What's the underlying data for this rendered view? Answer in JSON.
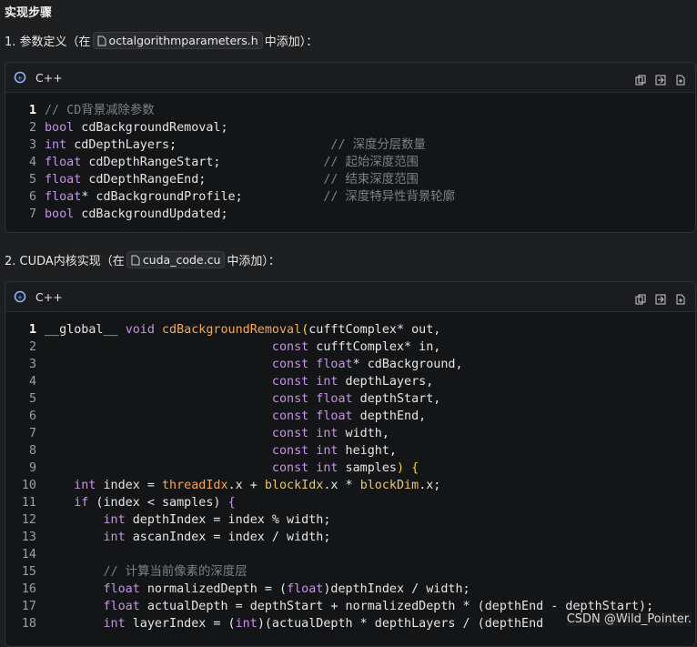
{
  "heading": "实现步骤",
  "step1": {
    "prefix": "1. 参数定义（在",
    "file": "octalgorithmparameters.h",
    "suffix": "中添加）："
  },
  "step2": {
    "prefix": "2. CUDA内核实现（在",
    "file": "cuda_code.cu",
    "suffix": "中添加）："
  },
  "card1": {
    "lang": "C++",
    "lines": [
      {
        "n": "1",
        "t": [
          [
            "cm",
            "// CD背景减除参数"
          ]
        ]
      },
      {
        "n": "2",
        "t": [
          [
            "kw",
            "bool"
          ],
          [
            "txt",
            " cdBackgroundRemoval;"
          ]
        ]
      },
      {
        "n": "3",
        "t": [
          [
            "kw",
            "int"
          ],
          [
            "txt",
            " cdDepthLayers;                     "
          ],
          [
            "cm",
            "// 深度分层数量"
          ]
        ]
      },
      {
        "n": "4",
        "t": [
          [
            "kw",
            "float"
          ],
          [
            "txt",
            " cdDepthRangeStart;              "
          ],
          [
            "cm",
            "// 起始深度范围"
          ]
        ]
      },
      {
        "n": "5",
        "t": [
          [
            "kw",
            "float"
          ],
          [
            "txt",
            " cdDepthRangeEnd;                "
          ],
          [
            "cm",
            "// 结束深度范围"
          ]
        ]
      },
      {
        "n": "6",
        "t": [
          [
            "kw",
            "float"
          ],
          [
            "txt",
            "* cdBackgroundProfile;           "
          ],
          [
            "cm",
            "// 深度特异性背景轮廓"
          ]
        ]
      },
      {
        "n": "7",
        "t": [
          [
            "kw",
            "bool"
          ],
          [
            "txt",
            " cdBackgroundUpdated;"
          ]
        ]
      }
    ]
  },
  "card2": {
    "lang": "C++",
    "lines": [
      {
        "n": "1",
        "t": [
          [
            "txt",
            "__global__ "
          ],
          [
            "kw",
            "void"
          ],
          [
            "txt",
            " "
          ],
          [
            "fn",
            "cdBackgroundRemoval"
          ],
          [
            "br",
            "("
          ],
          [
            "txt",
            "cufftComplex* out,"
          ]
        ]
      },
      {
        "n": "2",
        "t": [
          [
            "txt",
            "                               "
          ],
          [
            "kw",
            "const"
          ],
          [
            "txt",
            " cufftComplex* in,"
          ]
        ]
      },
      {
        "n": "3",
        "t": [
          [
            "txt",
            "                               "
          ],
          [
            "kw",
            "const"
          ],
          [
            "txt",
            " "
          ],
          [
            "kw",
            "float"
          ],
          [
            "txt",
            "* cdBackground,"
          ]
        ]
      },
      {
        "n": "4",
        "t": [
          [
            "txt",
            "                               "
          ],
          [
            "kw",
            "const"
          ],
          [
            "txt",
            " "
          ],
          [
            "kw",
            "int"
          ],
          [
            "txt",
            " depthLayers,"
          ]
        ]
      },
      {
        "n": "5",
        "t": [
          [
            "txt",
            "                               "
          ],
          [
            "kw",
            "const"
          ],
          [
            "txt",
            " "
          ],
          [
            "kw",
            "float"
          ],
          [
            "txt",
            " depthStart,"
          ]
        ]
      },
      {
        "n": "6",
        "t": [
          [
            "txt",
            "                               "
          ],
          [
            "kw",
            "const"
          ],
          [
            "txt",
            " "
          ],
          [
            "kw",
            "float"
          ],
          [
            "txt",
            " depthEnd,"
          ]
        ]
      },
      {
        "n": "7",
        "t": [
          [
            "txt",
            "                               "
          ],
          [
            "kw",
            "const"
          ],
          [
            "txt",
            " "
          ],
          [
            "kw",
            "int"
          ],
          [
            "txt",
            " width,"
          ]
        ]
      },
      {
        "n": "8",
        "t": [
          [
            "txt",
            "                               "
          ],
          [
            "kw",
            "const"
          ],
          [
            "txt",
            " "
          ],
          [
            "kw",
            "int"
          ],
          [
            "txt",
            " height,"
          ]
        ]
      },
      {
        "n": "9",
        "t": [
          [
            "txt",
            "                               "
          ],
          [
            "kw",
            "const"
          ],
          [
            "txt",
            " "
          ],
          [
            "kw",
            "int"
          ],
          [
            "txt",
            " samples"
          ],
          [
            "br",
            ")"
          ],
          [
            "txt",
            " "
          ],
          [
            "br",
            "{"
          ]
        ]
      },
      {
        "n": "10",
        "t": [
          [
            "txt",
            "    "
          ],
          [
            "kw",
            "int"
          ],
          [
            "txt",
            " index = "
          ],
          [
            "fn",
            "threadIdx"
          ],
          [
            "txt",
            ".x + "
          ],
          [
            "var",
            "blockIdx"
          ],
          [
            "txt",
            ".x * "
          ],
          [
            "var",
            "blockDim"
          ],
          [
            "txt",
            ".x;"
          ]
        ]
      },
      {
        "n": "11",
        "t": [
          [
            "txt",
            "    "
          ],
          [
            "kw",
            "if"
          ],
          [
            "txt",
            " (index < samples) "
          ],
          [
            "kw",
            "{"
          ]
        ]
      },
      {
        "n": "12",
        "t": [
          [
            "txt",
            "        "
          ],
          [
            "kw",
            "int"
          ],
          [
            "txt",
            " depthIndex = index % width;"
          ]
        ]
      },
      {
        "n": "13",
        "t": [
          [
            "txt",
            "        "
          ],
          [
            "kw",
            "int"
          ],
          [
            "txt",
            " ascanIndex = index / width;"
          ]
        ]
      },
      {
        "n": "14",
        "t": []
      },
      {
        "n": "15",
        "t": [
          [
            "txt",
            "        "
          ],
          [
            "cm",
            "// 计算当前像素的深度层"
          ]
        ]
      },
      {
        "n": "16",
        "t": [
          [
            "txt",
            "        "
          ],
          [
            "kw",
            "float"
          ],
          [
            "txt",
            " normalizedDepth = ("
          ],
          [
            "kw",
            "float"
          ],
          [
            "txt",
            ")depthIndex / width;"
          ]
        ]
      },
      {
        "n": "17",
        "t": [
          [
            "txt",
            "        "
          ],
          [
            "kw",
            "float"
          ],
          [
            "txt",
            " actualDepth = depthStart + normalizedDepth * (depthEnd - depthStart);"
          ]
        ]
      },
      {
        "n": "18",
        "t": [
          [
            "txt",
            "        "
          ],
          [
            "kw",
            "int"
          ],
          [
            "txt",
            " layerIndex = ("
          ],
          [
            "kw",
            "int"
          ],
          [
            "txt",
            ")(actualDepth * depthLayers / (depthEnd"
          ]
        ]
      }
    ]
  },
  "watermark": "CSDN @Wild_Pointer."
}
